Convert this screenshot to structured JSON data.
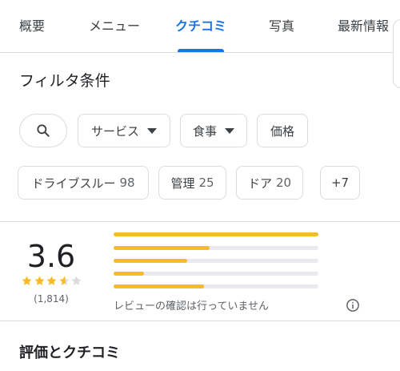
{
  "tabs": [
    {
      "label": "概要"
    },
    {
      "label": "メニュー"
    },
    {
      "label": "クチコミ",
      "active": true
    },
    {
      "label": "写真"
    },
    {
      "label": "最新情報"
    }
  ],
  "filter": {
    "title": "フィルタ条件",
    "search_icon": "search-icon",
    "chips_row1": [
      {
        "label": "サービス",
        "dropdown": true
      },
      {
        "label": "食事",
        "dropdown": true
      },
      {
        "label": "価格"
      }
    ],
    "chips_row2": [
      {
        "label": "ドライブスルー",
        "count": "98"
      },
      {
        "label": "管理",
        "count": "25"
      },
      {
        "label": "ドア",
        "count": "20"
      },
      {
        "label": "+7"
      }
    ]
  },
  "rating": {
    "average": "3.6",
    "stars_filled": 3.6,
    "count": "(1,814)",
    "distribution": [
      {
        "stars": 5,
        "fraction": 1.0
      },
      {
        "stars": 4,
        "fraction": 0.47
      },
      {
        "stars": 3,
        "fraction": 0.36
      },
      {
        "stars": 2,
        "fraction": 0.15
      },
      {
        "stars": 1,
        "fraction": 0.44
      }
    ],
    "unverified_note": "レビューの確認は行っていません",
    "info_icon": "info-icon"
  },
  "reviews_section": {
    "title": "評価とクチコミ"
  },
  "colors": {
    "accent": "#1a73e8",
    "star": "#f6bb28",
    "bar_track": "#e8eaed"
  }
}
